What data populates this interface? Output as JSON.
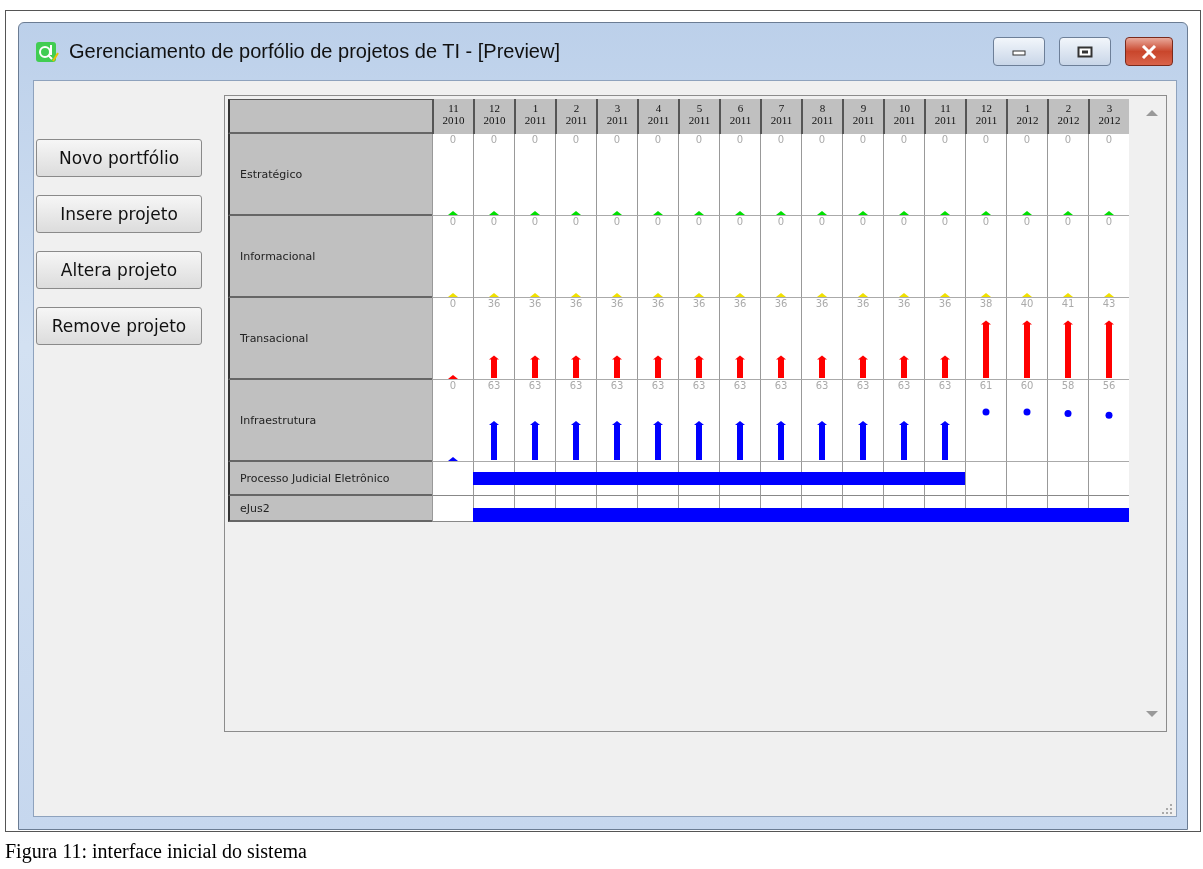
{
  "window": {
    "title": "Gerenciamento de porfólio de projetos de TI - [Preview]"
  },
  "buttons": [
    "Novo portfólio",
    "Insere projeto",
    "Altera projeto",
    "Remove projeto"
  ],
  "grid": {
    "months": [
      {
        "month": "11",
        "year": "2010"
      },
      {
        "month": "12",
        "year": "2010"
      },
      {
        "month": "1",
        "year": "2011"
      },
      {
        "month": "2",
        "year": "2011"
      },
      {
        "month": "3",
        "year": "2011"
      },
      {
        "month": "4",
        "year": "2011"
      },
      {
        "month": "5",
        "year": "2011"
      },
      {
        "month": "6",
        "year": "2011"
      },
      {
        "month": "7",
        "year": "2011"
      },
      {
        "month": "8",
        "year": "2011"
      },
      {
        "month": "9",
        "year": "2011"
      },
      {
        "month": "10",
        "year": "2011"
      },
      {
        "month": "11",
        "year": "2011"
      },
      {
        "month": "12",
        "year": "2011"
      },
      {
        "month": "1",
        "year": "2012"
      },
      {
        "month": "2",
        "year": "2012"
      },
      {
        "month": "3",
        "year": "2012"
      }
    ],
    "categories": [
      {
        "name": "Estratégico",
        "color": "#00e000",
        "cells": [
          {
            "value": "0",
            "kind": "bar",
            "level": 0
          },
          {
            "value": "0",
            "kind": "bar",
            "level": 0
          },
          {
            "value": "0",
            "kind": "bar",
            "level": 0
          },
          {
            "value": "0",
            "kind": "bar",
            "level": 0
          },
          {
            "value": "0",
            "kind": "bar",
            "level": 0
          },
          {
            "value": "0",
            "kind": "bar",
            "level": 0
          },
          {
            "value": "0",
            "kind": "bar",
            "level": 0
          },
          {
            "value": "0",
            "kind": "bar",
            "level": 0
          },
          {
            "value": "0",
            "kind": "bar",
            "level": 0
          },
          {
            "value": "0",
            "kind": "bar",
            "level": 0
          },
          {
            "value": "0",
            "kind": "bar",
            "level": 0
          },
          {
            "value": "0",
            "kind": "bar",
            "level": 0
          },
          {
            "value": "0",
            "kind": "bar",
            "level": 0
          },
          {
            "value": "0",
            "kind": "bar",
            "level": 0
          },
          {
            "value": "0",
            "kind": "bar",
            "level": 0
          },
          {
            "value": "0",
            "kind": "bar",
            "level": 0
          },
          {
            "value": "0",
            "kind": "bar",
            "level": 0
          }
        ]
      },
      {
        "name": "Informacional",
        "color": "#f0e000",
        "cells": [
          {
            "value": "0",
            "kind": "bar",
            "level": 0
          },
          {
            "value": "0",
            "kind": "bar",
            "level": 0
          },
          {
            "value": "0",
            "kind": "bar",
            "level": 0
          },
          {
            "value": "0",
            "kind": "bar",
            "level": 0
          },
          {
            "value": "0",
            "kind": "bar",
            "level": 0
          },
          {
            "value": "0",
            "kind": "bar",
            "level": 0
          },
          {
            "value": "0",
            "kind": "bar",
            "level": 0
          },
          {
            "value": "0",
            "kind": "bar",
            "level": 0
          },
          {
            "value": "0",
            "kind": "bar",
            "level": 0
          },
          {
            "value": "0",
            "kind": "bar",
            "level": 0
          },
          {
            "value": "0",
            "kind": "bar",
            "level": 0
          },
          {
            "value": "0",
            "kind": "bar",
            "level": 0
          },
          {
            "value": "0",
            "kind": "bar",
            "level": 0
          },
          {
            "value": "0",
            "kind": "bar",
            "level": 0
          },
          {
            "value": "0",
            "kind": "bar",
            "level": 0
          },
          {
            "value": "0",
            "kind": "bar",
            "level": 0
          },
          {
            "value": "0",
            "kind": "bar",
            "level": 0
          }
        ]
      },
      {
        "name": "Transacional",
        "color": "#ff0000",
        "cells": [
          {
            "value": "0",
            "kind": "bar",
            "level": 0
          },
          {
            "value": "36",
            "kind": "bar",
            "level": 0.25
          },
          {
            "value": "36",
            "kind": "bar",
            "level": 0.25
          },
          {
            "value": "36",
            "kind": "bar",
            "level": 0.25
          },
          {
            "value": "36",
            "kind": "bar",
            "level": 0.25
          },
          {
            "value": "36",
            "kind": "bar",
            "level": 0.25
          },
          {
            "value": "36",
            "kind": "bar",
            "level": 0.25
          },
          {
            "value": "36",
            "kind": "bar",
            "level": 0.25
          },
          {
            "value": "36",
            "kind": "bar",
            "level": 0.25
          },
          {
            "value": "36",
            "kind": "bar",
            "level": 0.25
          },
          {
            "value": "36",
            "kind": "bar",
            "level": 0.25
          },
          {
            "value": "36",
            "kind": "bar",
            "level": 0.25
          },
          {
            "value": "36",
            "kind": "bar",
            "level": 0.25
          },
          {
            "value": "38",
            "kind": "bar",
            "level": 0.7
          },
          {
            "value": "40",
            "kind": "bar",
            "level": 0.7
          },
          {
            "value": "41",
            "kind": "bar",
            "level": 0.7
          },
          {
            "value": "43",
            "kind": "bar",
            "level": 0.7
          }
        ]
      },
      {
        "name": "Infraestrutura",
        "color": "#0000ff",
        "cells": [
          {
            "value": "0",
            "kind": "bar",
            "level": 0
          },
          {
            "value": "63",
            "kind": "bar",
            "level": 0.46
          },
          {
            "value": "63",
            "kind": "bar",
            "level": 0.46
          },
          {
            "value": "63",
            "kind": "bar",
            "level": 0.46
          },
          {
            "value": "63",
            "kind": "bar",
            "level": 0.46
          },
          {
            "value": "63",
            "kind": "bar",
            "level": 0.46
          },
          {
            "value": "63",
            "kind": "bar",
            "level": 0.46
          },
          {
            "value": "63",
            "kind": "bar",
            "level": 0.46
          },
          {
            "value": "63",
            "kind": "bar",
            "level": 0.46
          },
          {
            "value": "63",
            "kind": "bar",
            "level": 0.46
          },
          {
            "value": "63",
            "kind": "bar",
            "level": 0.46
          },
          {
            "value": "63",
            "kind": "bar",
            "level": 0.46
          },
          {
            "value": "63",
            "kind": "bar",
            "level": 0.46
          },
          {
            "value": "61",
            "kind": "dot",
            "level": 0.6
          },
          {
            "value": "60",
            "kind": "dot",
            "level": 0.6
          },
          {
            "value": "58",
            "kind": "dot",
            "level": 0.58
          },
          {
            "value": "56",
            "kind": "dot",
            "level": 0.56
          }
        ]
      }
    ],
    "projects": [
      {
        "name": "Processo Judicial Eletrônico",
        "active": [
          false,
          true,
          true,
          true,
          true,
          true,
          true,
          true,
          true,
          true,
          true,
          true,
          true,
          false,
          false,
          false,
          false
        ]
      },
      {
        "name": "eJus2",
        "active": [
          false,
          true,
          true,
          true,
          true,
          true,
          true,
          true,
          true,
          true,
          true,
          true,
          true,
          true,
          true,
          true,
          true
        ]
      }
    ]
  },
  "caption": "Figura 11: interface inicial do sistema"
}
